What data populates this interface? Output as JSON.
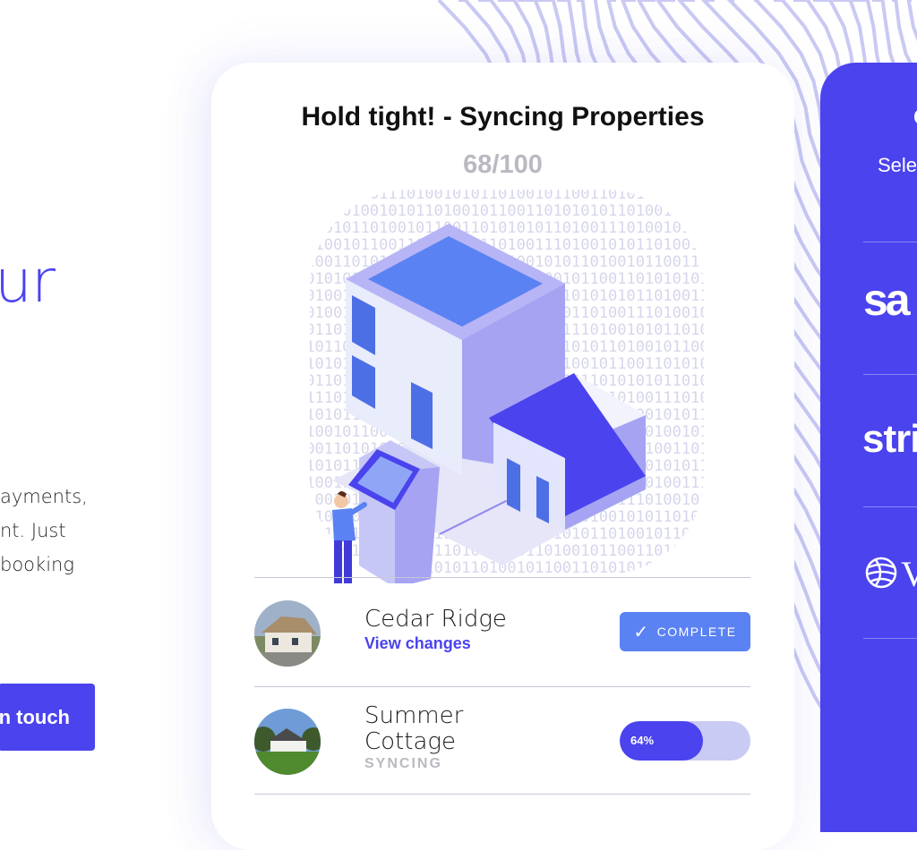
{
  "hero": {
    "heading": "ur",
    "lines": [
      "ayments,",
      "nt. Just",
      "booking"
    ],
    "cta_label": "n touch"
  },
  "sync_card": {
    "title": "Hold tight! - Syncing Properties",
    "progress_text": "68/100",
    "properties": [
      {
        "name": "Cedar Ridge",
        "link": "View changes",
        "status": "COMPLETE",
        "status_icon": "check-icon"
      },
      {
        "name_line1": "Summer",
        "name_line2": "Cottage",
        "status": "SYNCING",
        "progress_label": "64%",
        "progress": 0.64
      }
    ]
  },
  "integrations_panel": {
    "heading_fragment": "C",
    "subtitle": "Sele",
    "logos": [
      {
        "text": "sa",
        "icon": "sage-logo"
      },
      {
        "text": "stri",
        "icon": "stripe-logo"
      },
      {
        "text": "V",
        "icon": "globe-logo"
      }
    ]
  },
  "colors": {
    "accent": "#4a43ee",
    "complete": "#5b82f3",
    "muted": "#b9b9c2",
    "track": "#c9cbf4"
  }
}
